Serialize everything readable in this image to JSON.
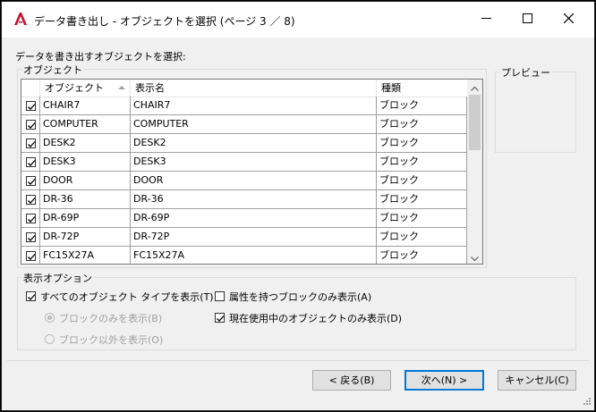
{
  "window": {
    "title": "データ書き出し - オブジェクトを選択 (ページ 3 ／ 8)",
    "app_icon": "autocad-a-icon"
  },
  "prompt_label": "データを書き出すオブジェクトを選択:",
  "objects_group_label": "オブジェクト",
  "preview_group_label": "プレビュー",
  "list": {
    "columns": [
      "オブジェクト",
      "表示名",
      "種類"
    ],
    "rows": [
      {
        "checked": true,
        "object": "CHAIR7",
        "display_name": "CHAIR7",
        "type": "ブロック"
      },
      {
        "checked": true,
        "object": "COMPUTER",
        "display_name": "COMPUTER",
        "type": "ブロック"
      },
      {
        "checked": true,
        "object": "DESK2",
        "display_name": "DESK2",
        "type": "ブロック"
      },
      {
        "checked": true,
        "object": "DESK3",
        "display_name": "DESK3",
        "type": "ブロック"
      },
      {
        "checked": true,
        "object": "DOOR",
        "display_name": "DOOR",
        "type": "ブロック"
      },
      {
        "checked": true,
        "object": "DR-36",
        "display_name": "DR-36",
        "type": "ブロック"
      },
      {
        "checked": true,
        "object": "DR-69P",
        "display_name": "DR-69P",
        "type": "ブロック"
      },
      {
        "checked": true,
        "object": "DR-72P",
        "display_name": "DR-72P",
        "type": "ブロック"
      },
      {
        "checked": true,
        "object": "FC15X27A",
        "display_name": "FC15X27A",
        "type": "ブロック"
      }
    ]
  },
  "display_options": {
    "group_label": "表示オプション",
    "show_all_types": {
      "label": "すべてのオブジェクト タイプを表示(T)",
      "checked": true
    },
    "blocks_only": {
      "label": "ブロックのみを表示(B)",
      "selected": true,
      "enabled": false
    },
    "non_blocks": {
      "label": "ブロック以外を表示(O)",
      "selected": false,
      "enabled": false
    },
    "attributes_only": {
      "label": "属性を持つブロックのみ表示(A)",
      "checked": false
    },
    "current_in_use": {
      "label": "現在使用中のオブジェクトのみ表示(D)",
      "checked": true
    }
  },
  "buttons": {
    "back": "< 戻る(B)",
    "next": "次へ(N) >",
    "cancel": "キャンセル(C)"
  },
  "colors": {
    "accent": "#0078d7",
    "brand": "#c8102e"
  }
}
